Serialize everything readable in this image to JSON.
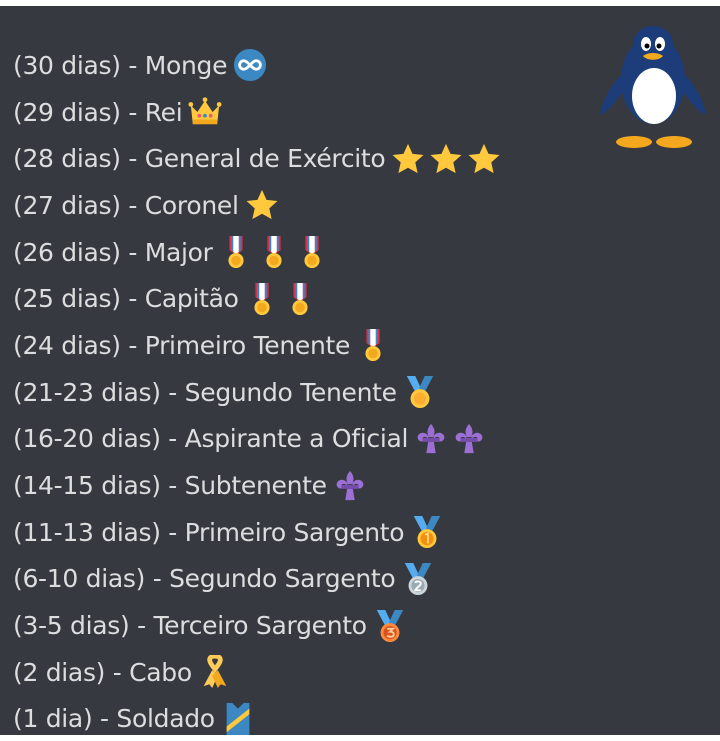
{
  "ranks": [
    {
      "label": "(30 dias) - Monge",
      "icons": [
        "infinity-icon"
      ]
    },
    {
      "label": "(29 dias) - Rei",
      "icons": [
        "crown-icon"
      ]
    },
    {
      "label": "(28 dias) - General de Exército",
      "icons": [
        "star-icon",
        "star-icon",
        "star-icon"
      ]
    },
    {
      "label": "(27 dias) - Coronel",
      "icons": [
        "star-icon"
      ]
    },
    {
      "label": "(26 dias) - Major",
      "icons": [
        "military-medal-icon",
        "military-medal-icon",
        "military-medal-icon"
      ]
    },
    {
      "label": "(25 dias) - Capitão",
      "icons": [
        "military-medal-icon",
        "military-medal-icon"
      ]
    },
    {
      "label": "(24 dias) - Primeiro Tenente",
      "icons": [
        "military-medal-icon"
      ]
    },
    {
      "label": "(21-23 dias) - Segundo Tenente",
      "icons": [
        "sports-medal-icon"
      ]
    },
    {
      "label": "(16-20 dias) - Aspirante a Oficial",
      "icons": [
        "fleur-de-lis-icon",
        "fleur-de-lis-icon"
      ]
    },
    {
      "label": "(14-15 dias) - Subtenente",
      "icons": [
        "fleur-de-lis-icon"
      ]
    },
    {
      "label": "(11-13 dias) - Primeiro Sargento",
      "icons": [
        "first-place-medal-icon"
      ]
    },
    {
      "label": "(6-10 dias) - Segundo Sargento",
      "icons": [
        "second-place-medal-icon"
      ]
    },
    {
      "label": "(3-5 dias) - Terceiro Sargento",
      "icons": [
        "third-place-medal-icon"
      ]
    },
    {
      "label": "(2 dias) - Cabo",
      "icons": [
        "ribbon-icon"
      ]
    },
    {
      "label": "(1 dia) - Soldado",
      "icons": [
        "sash-icon"
      ]
    }
  ],
  "colors": {
    "background": "#36393f",
    "text": "#dcddde",
    "gold": "#ffc83d",
    "purple": "#9b6fd3",
    "blue": "#3b88c3"
  }
}
